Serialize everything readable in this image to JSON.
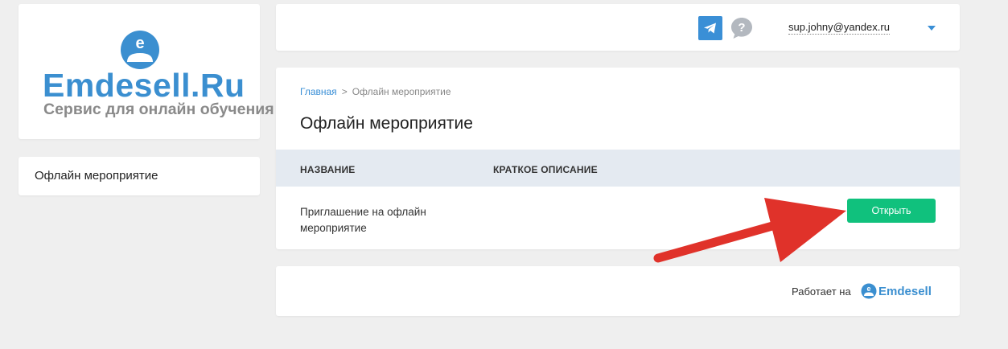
{
  "logo": {
    "title": "Emdesell",
    "title_suffix": ".Ru",
    "subtitle": "Сервис для онлайн обучения",
    "avatar_letter": "e"
  },
  "sidebar": {
    "items": [
      {
        "label": "Офлайн мероприятие"
      }
    ]
  },
  "header": {
    "telegram_icon": "telegram-icon",
    "help_icon": "question-chat-icon",
    "help_symbol": "?",
    "user_email": "sup.johny@yandex.ru",
    "dropdown_icon": "caret-down-icon"
  },
  "breadcrumb": {
    "home": "Главная",
    "separator": ">",
    "current": "Офлайн мероприятие"
  },
  "page": {
    "title": "Офлайн мероприятие"
  },
  "table": {
    "columns": [
      "НАЗВАНИЕ",
      "КРАТКОЕ ОПИСАНИЕ"
    ],
    "rows": [
      {
        "name": "Приглашение на офлайн мероприятие",
        "description": "",
        "action_label": "Открыть"
      }
    ]
  },
  "footer": {
    "powered_by": "Работает на",
    "brand": "Emdesell"
  },
  "colors": {
    "brand_blue": "#3b8fd0",
    "accent_green": "#10c17d",
    "annotation_red": "#e0322a",
    "table_header_bg": "#e4eaf1",
    "page_bg": "#efefef"
  }
}
